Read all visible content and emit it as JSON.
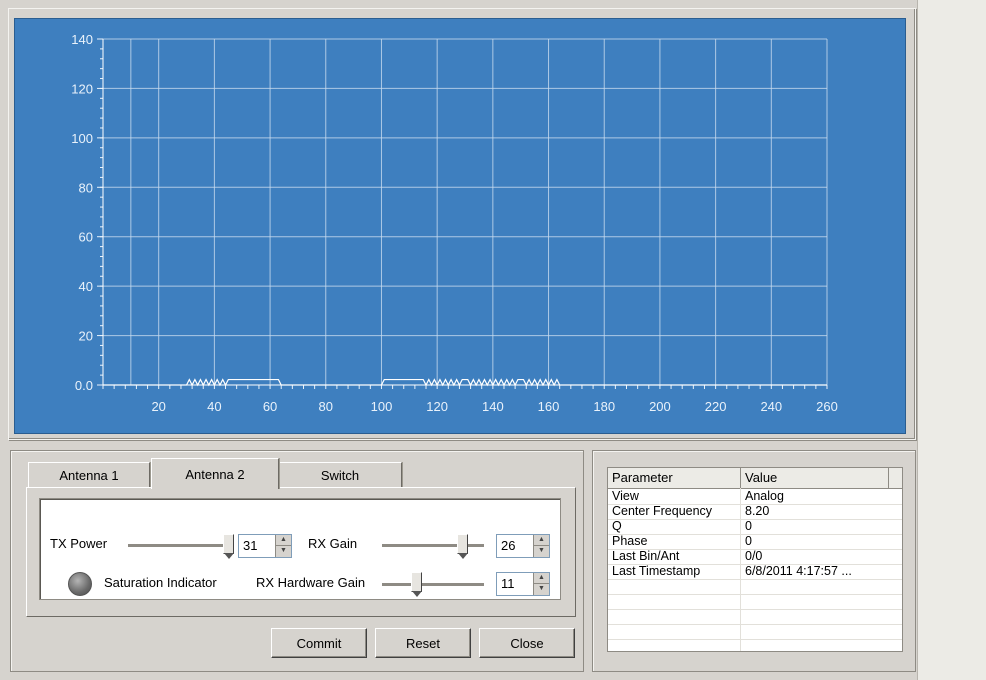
{
  "chart_data": {
    "type": "line",
    "xlim": [
      0,
      260
    ],
    "ylim": [
      0,
      140
    ],
    "x_ticks": [
      "20",
      "40",
      "60",
      "80",
      "100",
      "120",
      "140",
      "160",
      "180",
      "200",
      "220",
      "240",
      "260"
    ],
    "y_ticks": [
      "0.0",
      "20",
      "40",
      "60",
      "80",
      "100",
      "120",
      "140"
    ],
    "grid": true,
    "series": [
      {
        "values_x": [
          0,
          30,
          31,
          32,
          33,
          34,
          35,
          36,
          37,
          38,
          39,
          40,
          41,
          42,
          43,
          44,
          45,
          46,
          47,
          48,
          50,
          55,
          60,
          63,
          64,
          100,
          101,
          110,
          115,
          116,
          117,
          118,
          119,
          120,
          121,
          122,
          123,
          124,
          125,
          126,
          127,
          128,
          129,
          130,
          131,
          132,
          133,
          134,
          135,
          136,
          137,
          138,
          139,
          140,
          141,
          142,
          143,
          144,
          145,
          146,
          147,
          148,
          149,
          150,
          151,
          152,
          153,
          154,
          155,
          156,
          157,
          158,
          159,
          160,
          161,
          162,
          163,
          164,
          165,
          180,
          260
        ],
        "values_y": [
          0,
          0,
          1,
          0,
          1,
          0,
          1,
          0,
          1,
          0,
          1,
          0,
          1,
          0,
          1,
          0,
          1,
          1,
          1,
          1,
          1,
          1,
          1,
          1,
          0,
          0,
          1,
          1,
          1,
          0,
          1,
          0,
          1,
          0,
          1,
          0,
          1,
          0,
          1,
          0,
          1,
          0,
          1,
          1,
          1,
          0,
          1,
          0,
          1,
          0,
          1,
          0,
          1,
          0,
          1,
          0,
          1,
          0,
          1,
          0,
          1,
          0,
          1,
          1,
          1,
          0,
          1,
          0,
          1,
          0,
          1,
          0,
          1,
          0,
          1,
          0,
          1,
          0,
          0,
          0,
          0
        ]
      }
    ]
  },
  "tabs": [
    {
      "label": "Antenna 1"
    },
    {
      "label": "Antenna 2"
    },
    {
      "label": "Switch"
    }
  ],
  "antenna2": {
    "tx_power_label": "TX Power",
    "tx_power_value": "31",
    "tx_power_level": 0.94,
    "rx_gain_label": "RX Gain",
    "rx_gain_value": "26",
    "rx_gain_level": 0.78,
    "saturation_label": "Saturation Indicator",
    "rx_hw_gain_label": "RX Hardware Gain",
    "rx_hw_gain_value": "11",
    "rx_hw_gain_level": 0.33
  },
  "buttons": {
    "commit": "Commit",
    "reset": "Reset",
    "close": "Close"
  },
  "params": {
    "header_param": "Parameter",
    "header_value": "Value",
    "rows": [
      {
        "param": "View",
        "value": "Analog"
      },
      {
        "param": "Center Frequency",
        "value": "8.20"
      },
      {
        "param": "Q",
        "value": "0"
      },
      {
        "param": "Phase",
        "value": "0"
      },
      {
        "param": "Last Bin/Ant",
        "value": "0/0"
      },
      {
        "param": "Last Timestamp",
        "value": "6/8/2011 4:17:57 ..."
      }
    ]
  }
}
